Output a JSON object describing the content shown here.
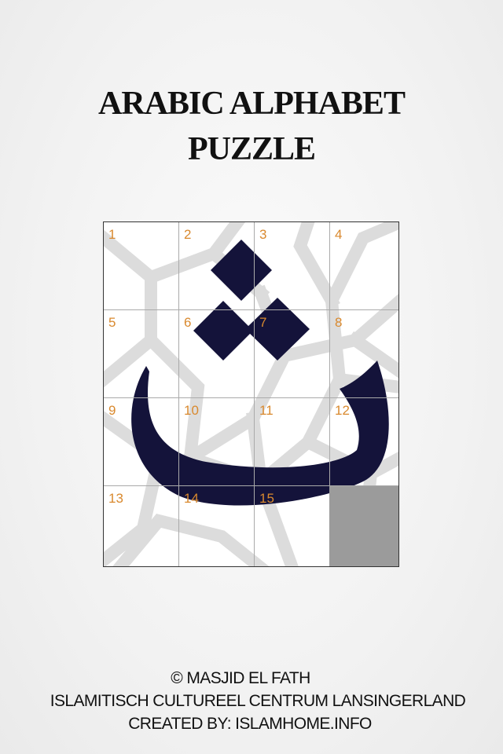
{
  "title": {
    "line1": "ARABIC ALPHABET",
    "line2": "PUZZLE"
  },
  "puzzle": {
    "tiles": [
      "1",
      "2",
      "3",
      "4",
      "5",
      "6",
      "7",
      "8",
      "9",
      "10",
      "11",
      "12",
      "13",
      "14",
      "15"
    ],
    "letter": "tha",
    "colors": {
      "letter": "#14133a",
      "tile_number": "#d9892e",
      "empty_slot": "#9b9b9b",
      "pattern": "#dcdcdc"
    }
  },
  "footer": {
    "copyright": "© MASJID EL FATH",
    "organization": "ISLAMITISCH CULTUREEL CENTRUM LANSINGERLAND",
    "created_by": "CREATED BY: ISLAMHOME.INFO"
  }
}
